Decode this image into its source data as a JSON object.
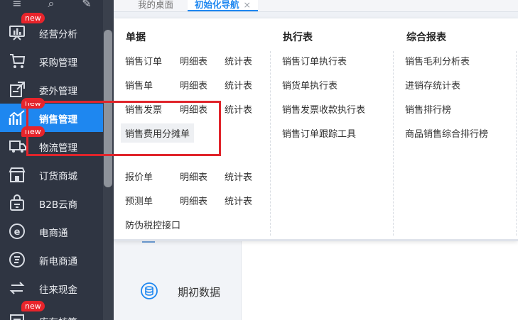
{
  "sidebar": {
    "items": [
      {
        "label": "经营分析",
        "badge": "new",
        "icon": "chart-board-icon"
      },
      {
        "label": "采购管理",
        "badge": "",
        "icon": "cart-icon"
      },
      {
        "label": "委外管理",
        "badge": "",
        "icon": "outsource-icon"
      },
      {
        "label": "销售管理",
        "badge": "new",
        "icon": "sales-chart-icon",
        "active": true
      },
      {
        "label": "物流管理",
        "badge": "new",
        "icon": "truck-icon"
      },
      {
        "label": "订货商城",
        "badge": "",
        "icon": "store-icon"
      },
      {
        "label": "B2B云商",
        "badge": "",
        "icon": "bag-icon"
      },
      {
        "label": "电商通",
        "badge": "",
        "icon": "e-circle-icon"
      },
      {
        "label": "新电商通",
        "badge": "",
        "icon": "new-e-circle-icon"
      },
      {
        "label": "往来现金",
        "badge": "",
        "icon": "exchange-icon"
      },
      {
        "label": "库存核算",
        "badge": "new",
        "icon": "inventory-icon"
      }
    ]
  },
  "tabs": {
    "desktop": "我的桌面",
    "init_nav": "初始化导航",
    "close_symbol": "×"
  },
  "menu": {
    "col1": {
      "title": "单据",
      "rows": [
        [
          "销售订单",
          "明细表",
          "统计表"
        ],
        [
          "销售单",
          "明细表",
          "统计表"
        ],
        [
          "销售发票",
          "明细表",
          "统计表"
        ],
        [
          "销售费用分摊单"
        ],
        [
          "报价单",
          "明细表",
          "统计表"
        ],
        [
          "预测单",
          "明细表",
          "统计表"
        ],
        [
          "防伪税控接口"
        ]
      ]
    },
    "col2": {
      "title": "执行表",
      "items": [
        "销售订单执行表",
        "销货单执行表",
        "销售发票收款执行表",
        "销售订单跟踪工具"
      ]
    },
    "col3": {
      "title": "综合报表",
      "items": [
        "销售毛利分析表",
        "进销存统计表",
        "销售排行榜",
        "商品销售综合排行榜"
      ]
    }
  },
  "content": {
    "init_data": "期初数据"
  },
  "colors": {
    "sidebar_bg": "#2f3542",
    "accent": "#1e87f0",
    "badge": "#e8242b",
    "highlight_box": "#e0242b"
  }
}
